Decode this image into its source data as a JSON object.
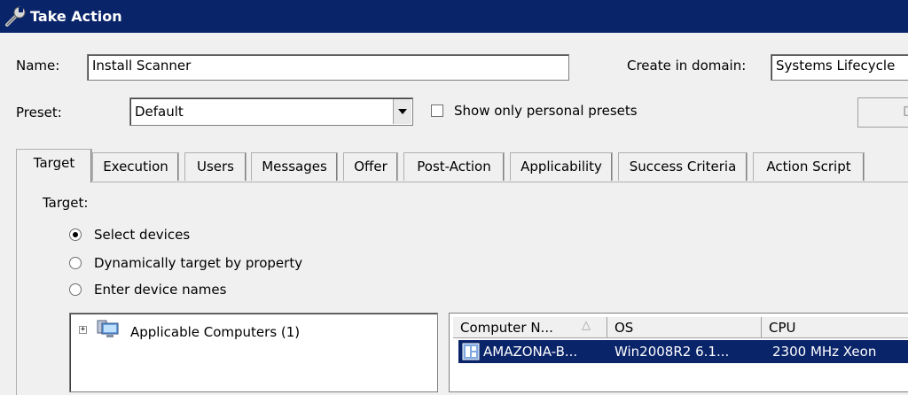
{
  "window": {
    "title": "Take Action",
    "icon": "wrench-icon"
  },
  "form": {
    "name_label": "Name:",
    "name_value": "Install Scanner",
    "domain_label": "Create in domain:",
    "domain_value": "Systems Lifecycle",
    "preset_label": "Preset:",
    "preset_value": "Default",
    "personal_presets_label": "Show only personal presets",
    "personal_presets_checked": false,
    "partial_button_label": "D"
  },
  "tabs": [
    {
      "label": "Target",
      "active": true
    },
    {
      "label": "Execution"
    },
    {
      "label": "Users"
    },
    {
      "label": "Messages"
    },
    {
      "label": "Offer"
    },
    {
      "label": "Post-Action"
    },
    {
      "label": "Applicability"
    },
    {
      "label": "Success Criteria"
    },
    {
      "label": "Action Script"
    }
  ],
  "target": {
    "heading": "Target:",
    "options": [
      {
        "label": "Select devices",
        "selected": true
      },
      {
        "label": "Dynamically target by property",
        "selected": false
      },
      {
        "label": "Enter device names",
        "selected": false
      }
    ]
  },
  "tree": {
    "expander": "+",
    "items": [
      {
        "label": "Applicable Computers (1)",
        "icon": "computers-group-icon"
      }
    ]
  },
  "grid": {
    "columns": [
      "Computer N...",
      "OS",
      "CPU"
    ],
    "sort_indicator": "△",
    "rows": [
      {
        "computer": "AMAZONA-B...",
        "os": "Win2008R2 6.1...",
        "cpu": "2300 MHz Xeon",
        "icon": "computer-icon",
        "selected": true
      }
    ]
  },
  "colors": {
    "titlebar": "#0a246a",
    "selection": "#0a246a",
    "window_bg": "#f0f0f0"
  }
}
